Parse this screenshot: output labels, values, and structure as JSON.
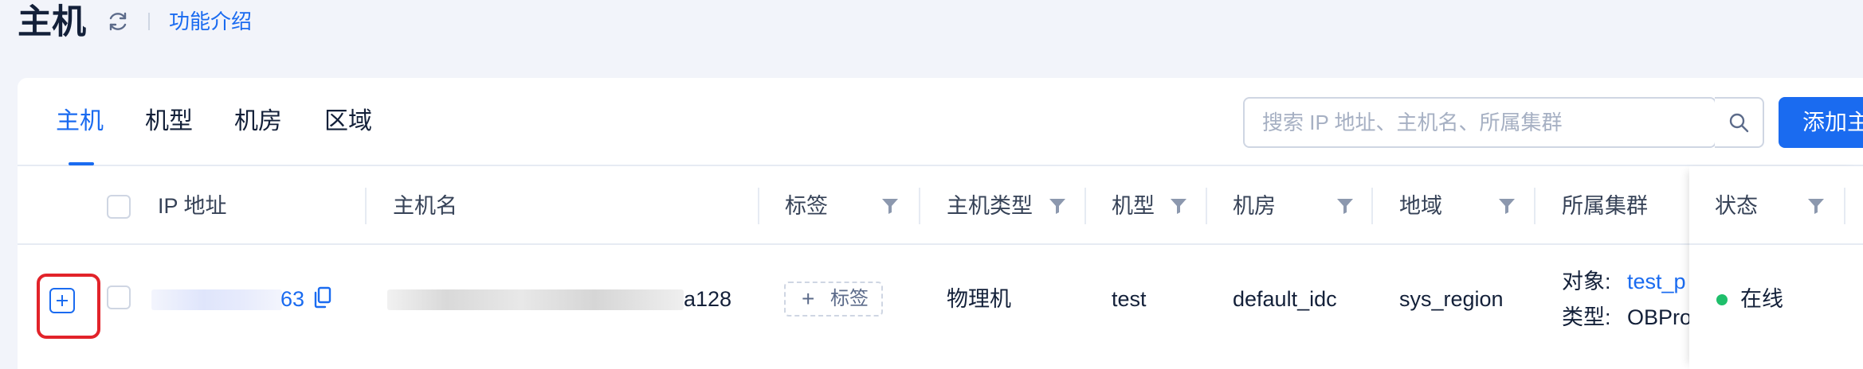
{
  "header": {
    "title": "主机",
    "intro_link": "功能介绍"
  },
  "tabs": [
    {
      "label": "主机",
      "active": true
    },
    {
      "label": "机型",
      "active": false
    },
    {
      "label": "机房",
      "active": false
    },
    {
      "label": "区域",
      "active": false
    }
  ],
  "search": {
    "placeholder": "搜索 IP 地址、主机名、所属集群"
  },
  "toolbar": {
    "add_button_label": "添加主"
  },
  "table": {
    "columns": {
      "ip": "IP 地址",
      "hostname": "主机名",
      "tags": "标签",
      "host_type": "主机类型",
      "model": "机型",
      "idc": "机房",
      "region": "地域",
      "cluster": "所属集群",
      "status": "状态"
    },
    "rows": [
      {
        "ip_suffix": "63",
        "hostname_suffix": "a128",
        "tag_button": "标签",
        "tag_plus": "+",
        "host_type": "物理机",
        "model": "test",
        "idc": "default_idc",
        "region": "sys_region",
        "cluster_object_label": "对象:",
        "cluster_object_value": "test_p",
        "cluster_type_label": "类型:",
        "cluster_type_value": "OBPro",
        "status": "在线"
      }
    ]
  },
  "colors": {
    "accent": "#1a6bf0",
    "online": "#1fbf6b",
    "highlight_border": "#e2232a"
  }
}
